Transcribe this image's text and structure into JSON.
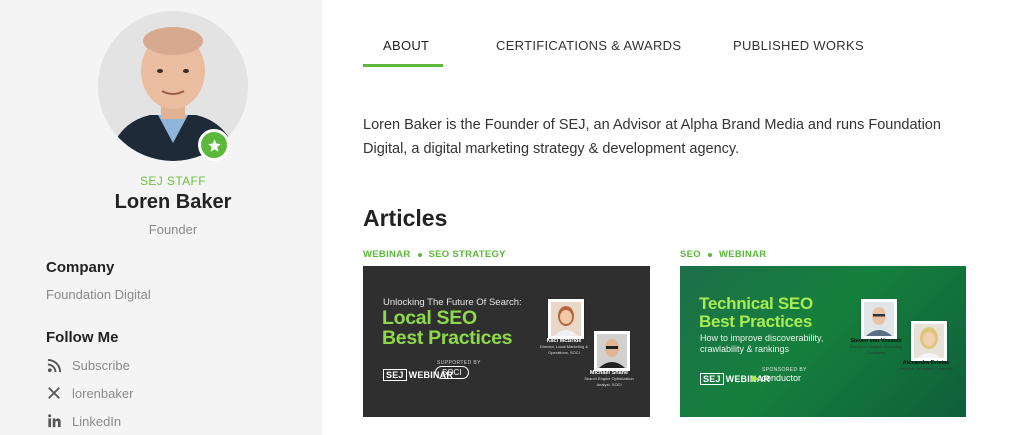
{
  "profile": {
    "staff_label": "SEJ STAFF",
    "name": "Loren Baker",
    "role": "Founder",
    "badge_icon": "star-icon",
    "accent_color": "#5cb83a"
  },
  "company": {
    "title": "Company",
    "value": "Foundation Digital"
  },
  "follow": {
    "title": "Follow Me",
    "links": [
      {
        "icon": "rss-icon",
        "label": "Subscribe"
      },
      {
        "icon": "x-icon",
        "label": "lorenbaker"
      },
      {
        "icon": "linkedin-icon",
        "label": "LinkedIn"
      }
    ]
  },
  "tabs": [
    {
      "label": "ABOUT",
      "active": true
    },
    {
      "label": "CERTIFICATIONS & AWARDS",
      "active": false
    },
    {
      "label": "PUBLISHED WORKS",
      "active": false
    }
  ],
  "bio": "Loren Baker is the Founder of SEJ, an Advisor at Alpha Brand Media and runs Foundation Digital, a digital marketing strategy & development agency.",
  "articles": {
    "title": "Articles",
    "items": [
      {
        "tags": [
          "WEBINAR",
          "SEO STRATEGY"
        ],
        "kicker": "Unlocking The Future Of Search:",
        "title_line1": "Local SEO",
        "title_line2": "Best Practices",
        "brand": "SEJ",
        "brand_suffix": "WEBINAR",
        "sponsor_label": "SUPPORTED BY",
        "sponsor": "SOCI",
        "speakers": [
          {
            "name": "Kaci McBride",
            "role": "Director, Local Marketing & Operations, SOCI"
          },
          {
            "name": "Michael Shane",
            "role": "Search Engine Optimization Analyst, SOCI"
          }
        ]
      },
      {
        "tags": [
          "SEO",
          "WEBINAR"
        ],
        "title_line1": "Technical SEO",
        "title_line2": "Best Practices",
        "subtitle": "How to improve discoverability, crawlability & rankings",
        "brand": "SEJ",
        "brand_suffix": "WEBINAR",
        "sponsor_label": "SPONSORED BY",
        "sponsor": "conductor",
        "speakers": [
          {
            "name": "Steven van Vessum",
            "role": "Director of Organic Marketing, Conductor"
          },
          {
            "name": "Alexandra Dristas",
            "role": "Principal Strategist, Conductor"
          }
        ]
      }
    ]
  }
}
